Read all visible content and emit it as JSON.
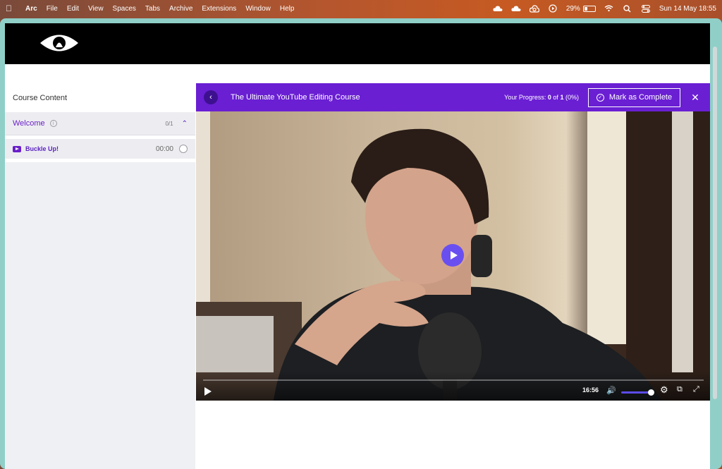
{
  "menubar": {
    "apple": "",
    "items": [
      "Arc",
      "File",
      "Edit",
      "View",
      "Spaces",
      "Tabs",
      "Archive",
      "Extensions",
      "Window",
      "Help"
    ],
    "battery": "29%",
    "datetime": "Sun 14 May  18:55"
  },
  "sidebar": {
    "heading": "Course Content",
    "section": {
      "title": "Welcome",
      "count": "0/1",
      "chevron": "⌃"
    },
    "lesson": {
      "title": "Buckle Up!",
      "duration": "00:00"
    }
  },
  "player": {
    "back": "‹",
    "course_title": "The Ultimate YouTube Editing Course",
    "progress": {
      "label": "Your Progress:",
      "done": "0",
      "of": "of",
      "total": "1",
      "percent": "(0%)"
    },
    "mark_complete": "Mark as Complete",
    "close": "✕",
    "time": "16:56",
    "volume_level": 0.88
  },
  "colors": {
    "brand": "#6a1fd3",
    "accent": "#6a4ff0",
    "window": "#8fcfc8"
  }
}
